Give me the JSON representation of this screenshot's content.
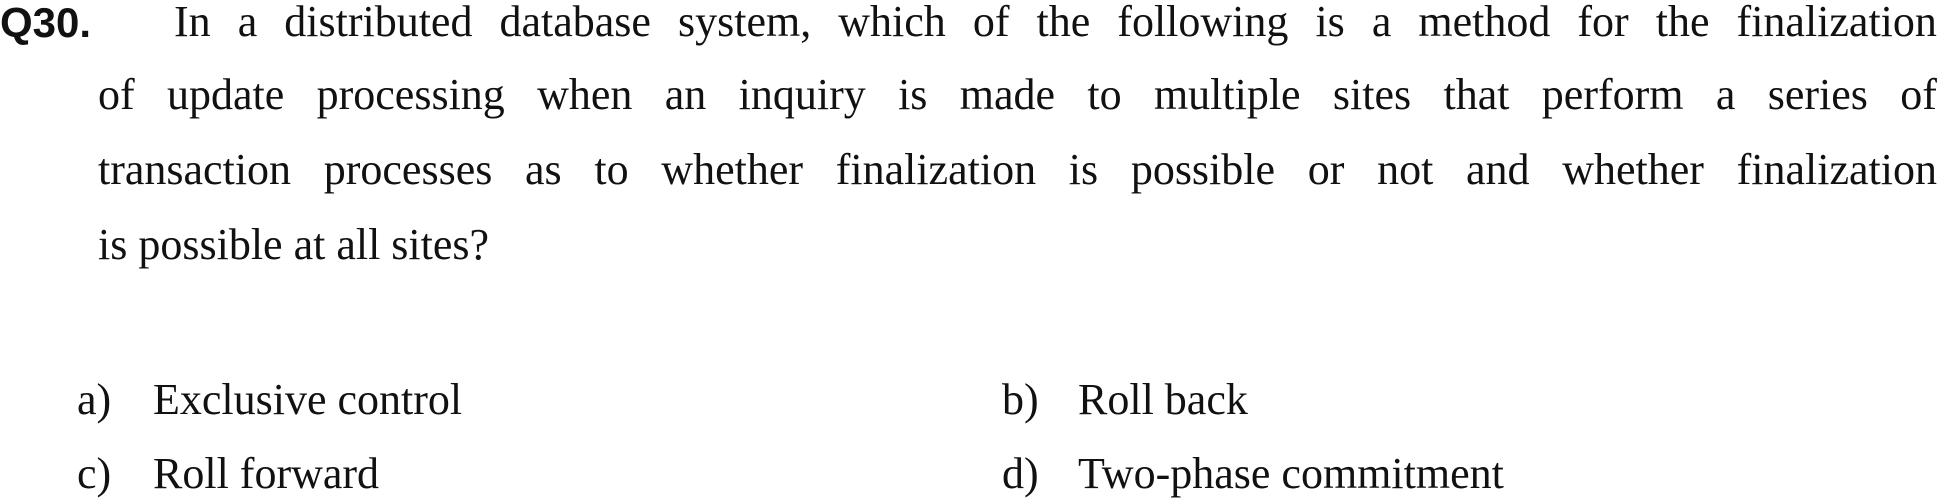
{
  "question": {
    "number": "Q30.",
    "lines": [
      "In a distributed database system, which of the following is a method for the finalization",
      "of update processing when an inquiry is made to multiple sites that perform a series of",
      "transaction processes as to whether finalization is possible or not and whether finalization",
      "is possible at all sites?"
    ]
  },
  "options": [
    {
      "letter": "a)",
      "text": "Exclusive control"
    },
    {
      "letter": "b)",
      "text": "Roll back"
    },
    {
      "letter": "c)",
      "text": "Roll forward"
    },
    {
      "letter": "d)",
      "text": "Two-phase commitment"
    }
  ]
}
